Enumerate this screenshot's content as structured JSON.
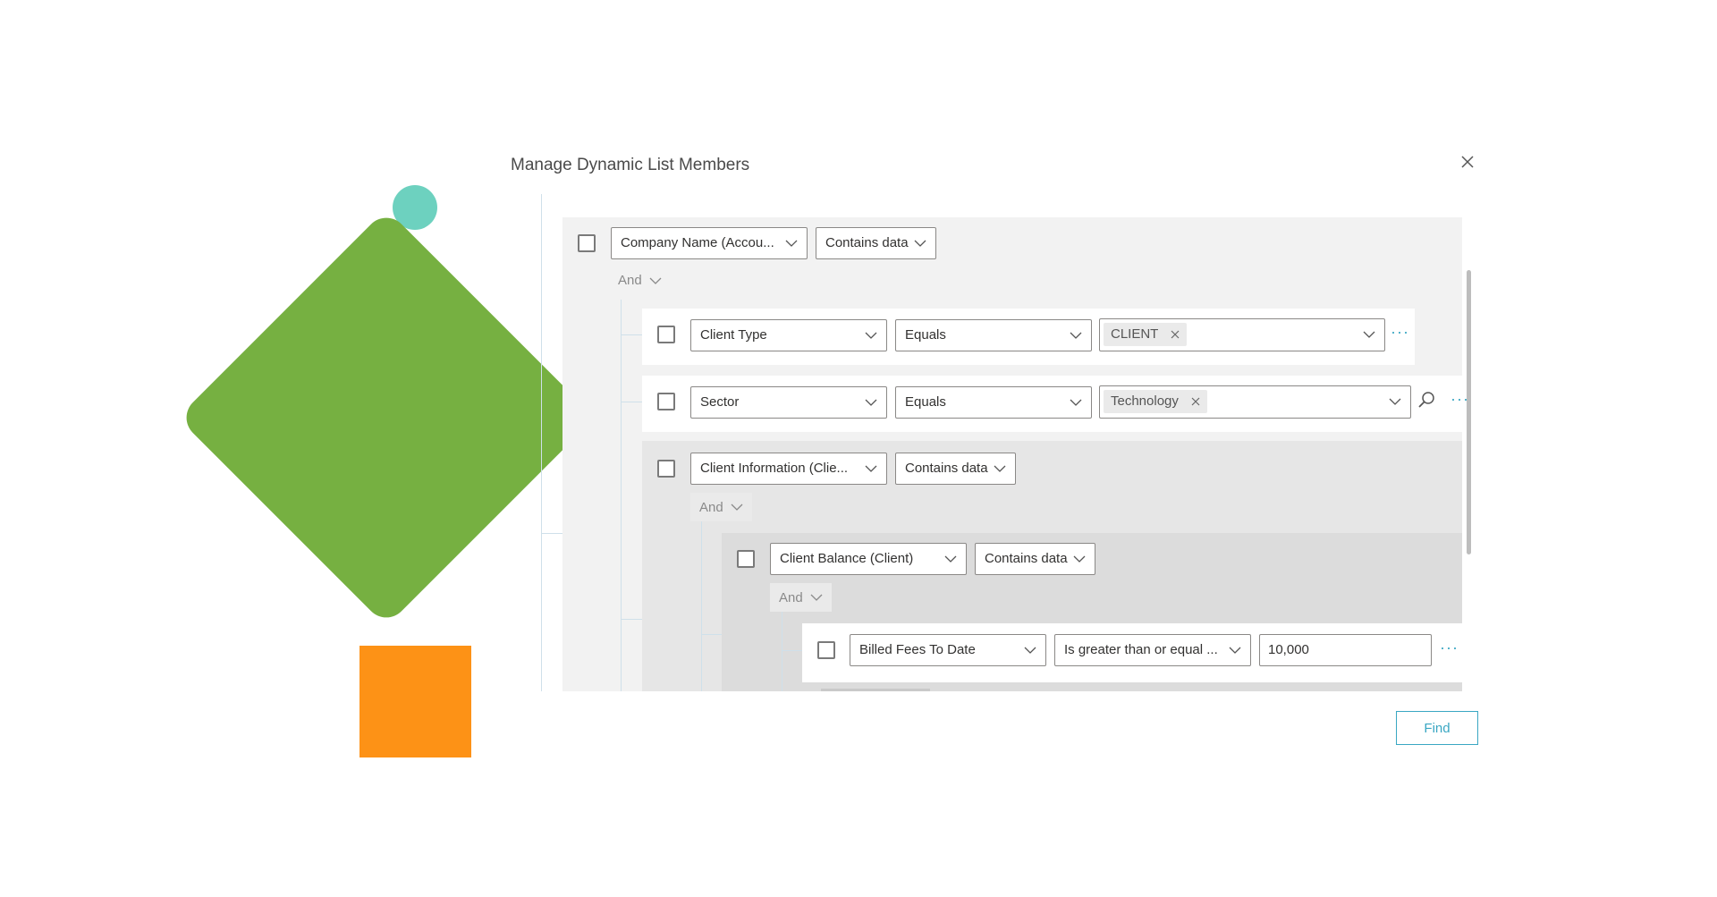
{
  "dialog": {
    "title": "Manage Dynamic List Members",
    "find_label": "Find"
  },
  "rows": {
    "company": {
      "field": "Company Name (Accou...",
      "operator": "Contains data"
    },
    "and_1": "And",
    "client_type": {
      "field": "Client Type",
      "operator": "Equals",
      "value_tag": "CLIENT",
      "more": "···"
    },
    "sector": {
      "field": "Sector",
      "operator": "Equals",
      "value_tag": "Technology",
      "more": "···"
    },
    "client_info": {
      "field": "Client Information (Clie...",
      "operator": "Contains data"
    },
    "and_2": "And",
    "client_balance": {
      "field": "Client Balance (Client)",
      "operator": "Contains data"
    },
    "and_3": "And",
    "billed_fees": {
      "field": "Billed Fees To Date",
      "operator": "Is greater than or equal ...",
      "value": "10,000",
      "more": "···"
    }
  },
  "colors": {
    "accent": "#3aa7c3",
    "decor_circle": "#6dd1bf",
    "decor_diamond": "#76b041",
    "decor_square": "#fd9216"
  }
}
